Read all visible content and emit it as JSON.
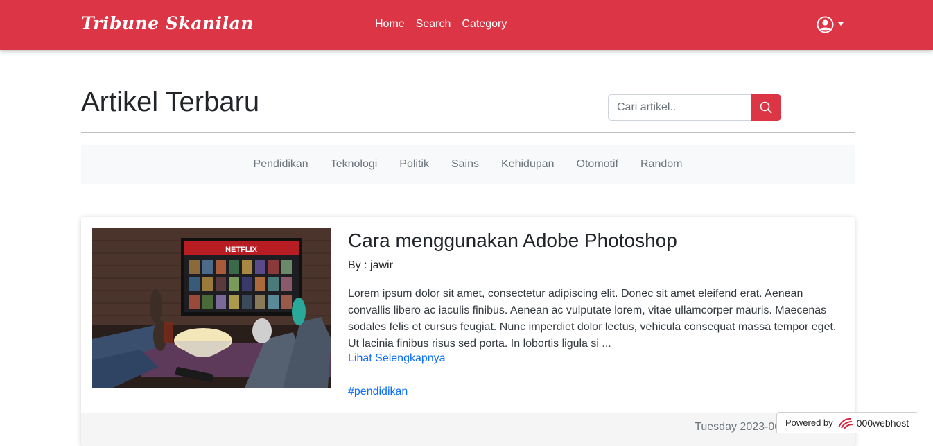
{
  "navbar": {
    "brand": "Tribune Skanilan",
    "links": [
      "Home",
      "Search",
      "Category"
    ],
    "user_icon": "user-circle-icon"
  },
  "header": {
    "title": "Artikel Terbaru",
    "search_placeholder": "Cari artikel..",
    "search_icon": "search-icon"
  },
  "categories": [
    "Pendidikan",
    "Teknologi",
    "Politik",
    "Sains",
    "Kehidupan",
    "Otomotif",
    "Random"
  ],
  "article": {
    "title": "Cara menggunakan Adobe Photoshop",
    "author": "By : jawir",
    "excerpt": "Lorem ipsum dolor sit amet, consectetur adipiscing elit. Donec sit amet eleifend erat. Aenean convallis libero ac iaculis finibus. Aenean ac vulputate lorem, vitae ullamcorper mauris. Maecenas sodales felis et cursus feugiat. Nunc imperdiet dolor lectus, vehicula consequat massa tempor eget. Ut lacinia finibus risus sed porta. In lobortis ligula si ...",
    "read_more": "Lihat Selengkapnya",
    "tag": "#pendidikan",
    "date": "Tuesday 2023-06-06 02:43:26",
    "image_text": "NETFLIX"
  },
  "badge": {
    "prefix": "Powered by",
    "host": "000webhost"
  },
  "colors": {
    "primary": "#dc3545",
    "link": "#0d6efd",
    "muted": "#6c757d"
  }
}
